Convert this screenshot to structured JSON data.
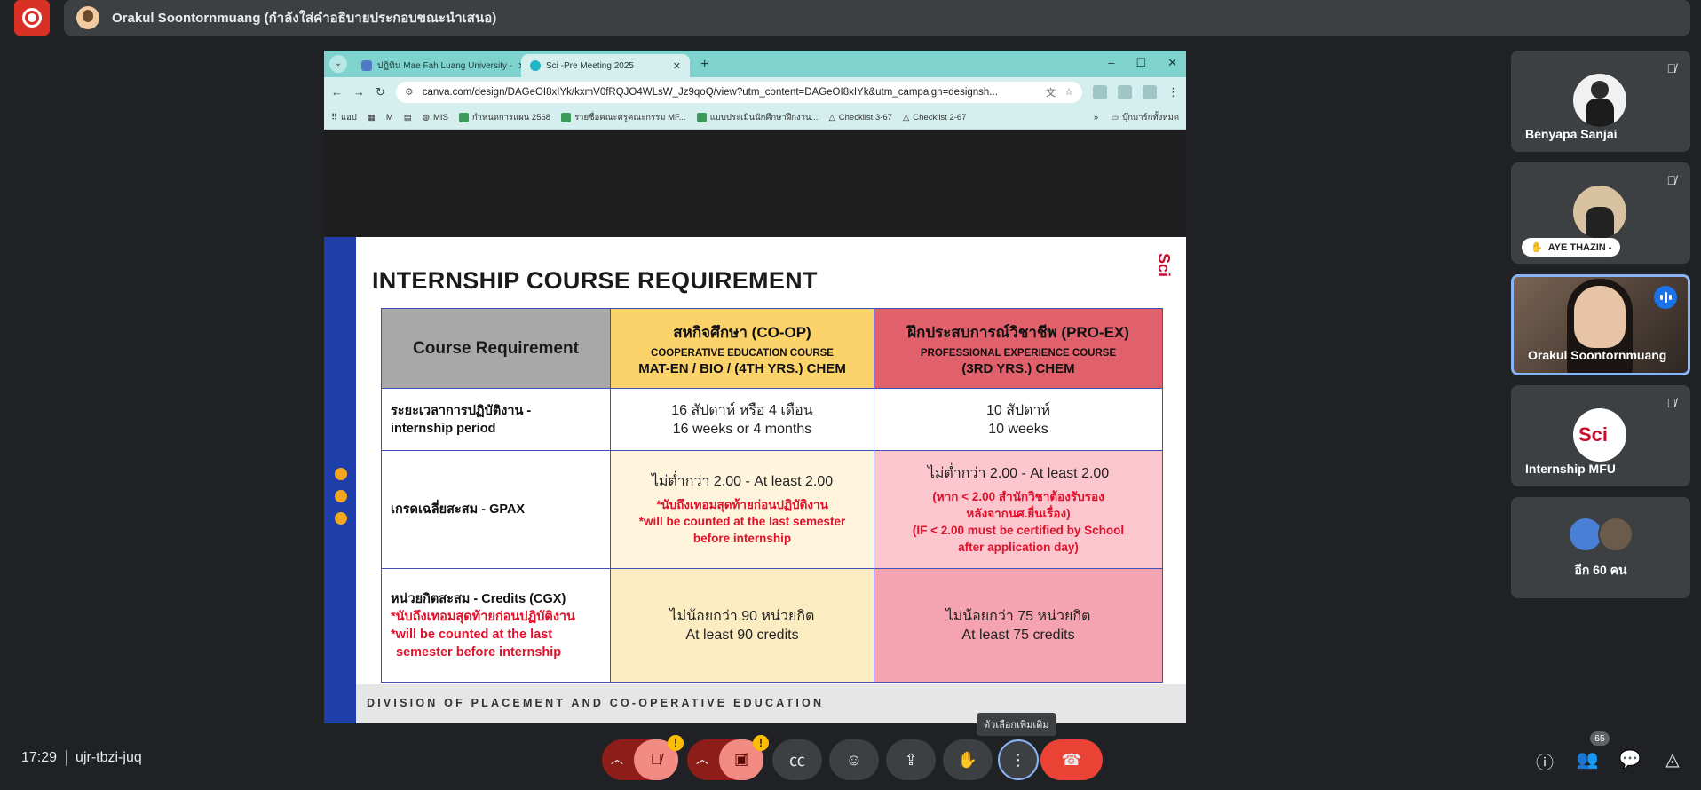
{
  "top_bar": {
    "presenter_text": "Orakul Soontornmuang (กำลังใส่คำอธิบายประกอบขณะนำเสนอ)"
  },
  "browser": {
    "tabs": [
      {
        "label": "ปฏิทิน Mae Fah Luang University - ",
        "active": false
      },
      {
        "label": "Sci -Pre Meeting 2025",
        "active": true
      }
    ],
    "url": "canva.com/design/DAGeOI8xIYk/kxmV0fRQJO4WLsW_Jz9qoQ/view?utm_content=DAGeOI8xIYk&utm_campaign=designsh...",
    "bookmarks": [
      "แอป",
      "MIS",
      "กำหนดการแผน 2568",
      "รายชื่อคณะครูคณะกรรม MF...",
      "แบบประเมินนักศึกษาฝึกงาน...",
      "Checklist 3-67",
      "Checklist 2-67"
    ],
    "bookmarks_folder": "บุ๊กมาร์กทั้งหมด"
  },
  "slide": {
    "title": "INTERNSHIP COURSE REQUIREMENT",
    "logo": "Sci",
    "footer": "DIVISION OF PLACEMENT AND CO-OPERATIVE EDUCATION",
    "header": {
      "col0": "Course Requirement",
      "coop_main": "สหกิจศึกษา (CO-OP)",
      "coop_sub": "COOPERATIVE EDUCATION COURSE",
      "coop_line": "MAT-EN / BIO / (4TH YRS.) CHEM",
      "proex_main": "ฝึกประสบการณ์วิชาชีพ (PRO-EX)",
      "proex_sub": "PROFESSIONAL EXPERIENCE COURSE",
      "proex_line": "(3RD YRS.) CHEM"
    },
    "rows": [
      {
        "label_1": "ระยะเวลาการปฏิบัติงาน -",
        "label_2": "internship period",
        "coop_1": "16 สัปดาห์ หรือ 4 เดือน",
        "coop_2": "16 weeks or 4 months",
        "proex_1": "10 สัปดาห์",
        "proex_2": "10 weeks"
      },
      {
        "label_1": "เกรดเฉลี่ยสะสม - GPAX",
        "coop_1": "ไม่ต่ำกว่า 2.00 - At least 2.00",
        "coop_note_1": "*นับถึงเทอมสุดท้ายก่อนปฏิบัติงาน",
        "coop_note_2": "*will be counted at the last semester",
        "coop_note_3": "before internship",
        "proex_1": "ไม่ต่ำกว่า 2.00 - At least 2.00",
        "proex_note_1": "(หาก < 2.00 สำนักวิชาต้องรับรอง",
        "proex_note_2": "หลังจากนศ.ยื่นเรื่อง)",
        "proex_note_3": "(IF < 2.00 must be certified by School",
        "proex_note_4": "after application day)"
      },
      {
        "label_1": "หน่วยกิตสะสม - Credits (CGX)",
        "label_note_1": "*นับถึงเทอมสุดท้ายก่อนปฏิบัติงาน",
        "label_note_2": "*will be counted at the last",
        "label_note_3": "semester before internship",
        "coop_1": "ไม่น้อยกว่า 90 หน่วยกิต",
        "coop_2": "At least 90 credits",
        "proex_1": "ไม่น้อยกว่า 75 หน่วยกิต",
        "proex_2": "At least 75 credits"
      }
    ]
  },
  "participants": [
    {
      "name": "Benyapa Sanjai",
      "muted": true
    },
    {
      "name": "AYE THAZIN -",
      "muted": true,
      "hand_raised": true
    },
    {
      "name": "Orakul Soontornmuang",
      "speaking": true
    },
    {
      "name": "Internship MFU",
      "muted": true
    },
    {
      "name": "อีก 60 คน"
    }
  ],
  "bottom_bar": {
    "time": "17:29",
    "meeting_code": "ujr-tbzi-juq",
    "more_options_tooltip": "ตัวเลือกเพิ่มเติม",
    "people_count": "65"
  },
  "colors": {
    "meet_bg": "#202124",
    "end_call": "#ea4335",
    "coop_header": "#fcd36b",
    "proex_header": "#e0606b",
    "slide_accent": "#1e3eaa"
  }
}
